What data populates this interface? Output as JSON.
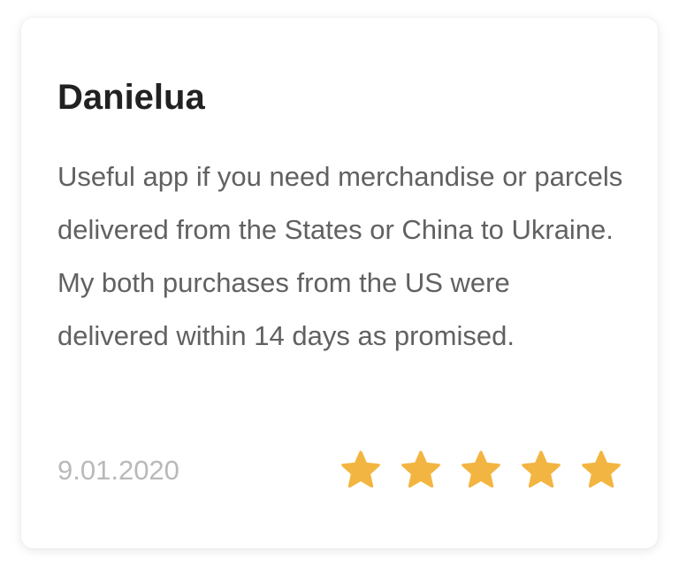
{
  "review": {
    "author": "Danielua",
    "text": "Useful app if you need merchandise or parcels delivered from the States or China to Ukraine. My both purchases from the US were delivered within 14 days as promised.",
    "date": "9.01.2020",
    "rating": 5,
    "max_rating": 5
  },
  "colors": {
    "star": "#F3B541",
    "author": "#222222",
    "text": "#616161",
    "date": "#B9B9B9"
  },
  "icons": {
    "rating_star": "star-icon"
  }
}
